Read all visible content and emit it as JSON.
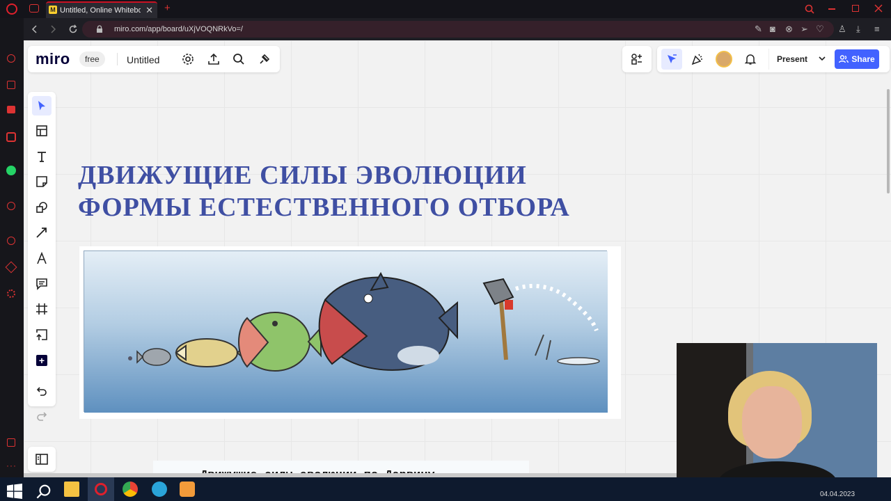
{
  "browser": {
    "tab_title": "Untitled, Online Whiteboard",
    "tab_close": "✕",
    "new_tab": "+",
    "url": "miro.com/app/board/uXjVOQNRkVo=/"
  },
  "miro": {
    "logo": "miro",
    "plan_badge": "free",
    "board_name": "Untitled",
    "present_label": "Present",
    "share_label": "Share"
  },
  "board": {
    "heading_line1": "ДВИЖУЩИЕ СИЛЫ ЭВОЛЮЦИИ",
    "heading_line2": "ФОРМЫ ЕСТЕСТВЕННОГО ОТБОРА",
    "subheading": "Движущие силы эволюции по Дарвину"
  },
  "taskbar": {
    "date": "04.04.2023"
  },
  "colors": {
    "heading": "#3f4fa3",
    "share_button": "#4262ff",
    "opera_red": "#e0202c"
  }
}
